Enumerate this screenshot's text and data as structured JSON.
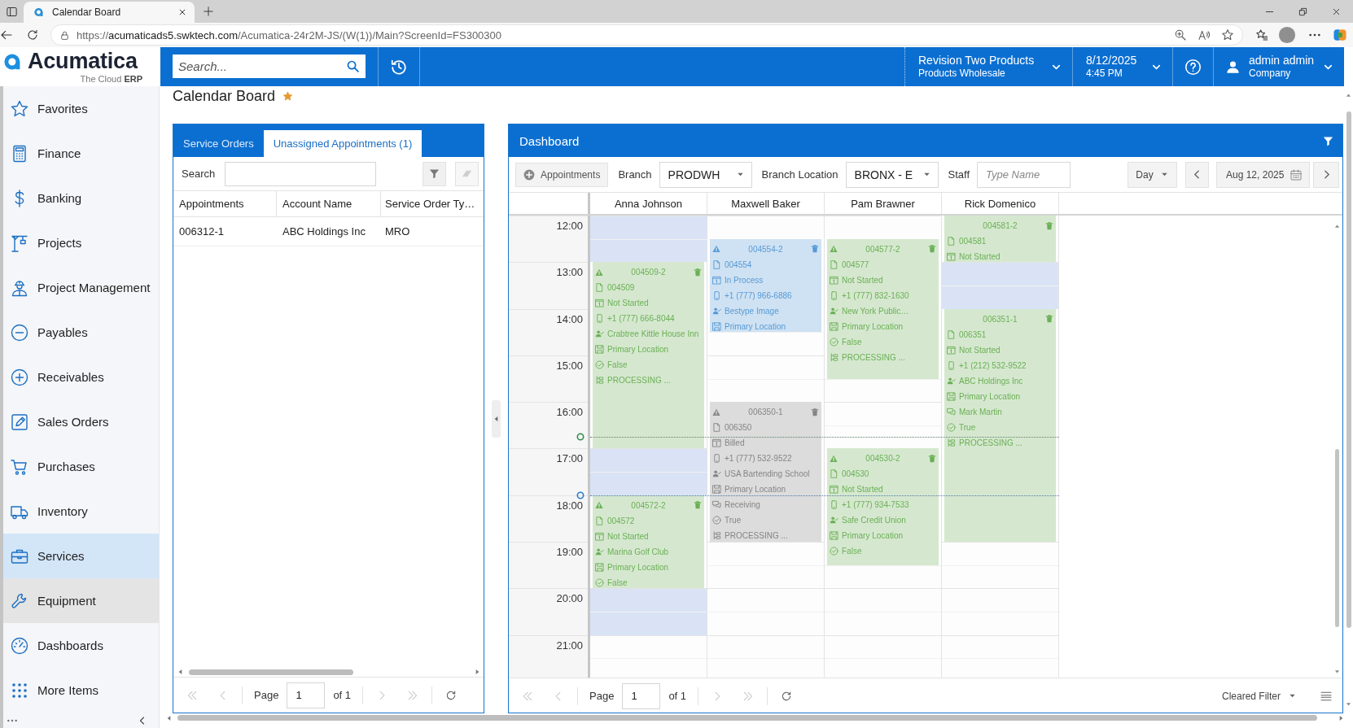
{
  "browser": {
    "tab_title": "Calendar Board",
    "url": {
      "scheme": "https://",
      "host": "acumaticads5.swktech.com",
      "path": "/Acumatica-24r2M-JS/(W(1))/Main?ScreenId=FS300300"
    }
  },
  "header": {
    "logo": {
      "name": "Acumatica",
      "tagline": "The Cloud **ERP**"
    },
    "search": {
      "placeholder": "Search..."
    },
    "company": {
      "name": "Revision Two Products",
      "branch": "Products Wholesale"
    },
    "datetime": {
      "date": "8/12/2025",
      "time": "4:45 PM"
    },
    "user": {
      "name": "admin admin",
      "company": "Company"
    }
  },
  "sidebar": {
    "items": [
      {
        "label": "Favorites",
        "selected": false,
        "hovered": false
      },
      {
        "label": "Finance",
        "selected": false,
        "hovered": false
      },
      {
        "label": "Banking",
        "selected": false,
        "hovered": false
      },
      {
        "label": "Projects",
        "selected": false,
        "hovered": false
      },
      {
        "label": "Project Management",
        "selected": false,
        "hovered": false
      },
      {
        "label": "Payables",
        "selected": false,
        "hovered": false
      },
      {
        "label": "Receivables",
        "selected": false,
        "hovered": false
      },
      {
        "label": "Sales Orders",
        "selected": false,
        "hovered": false
      },
      {
        "label": "Purchases",
        "selected": false,
        "hovered": false
      },
      {
        "label": "Inventory",
        "selected": false,
        "hovered": false
      },
      {
        "label": "Services",
        "selected": true,
        "hovered": false
      },
      {
        "label": "Equipment",
        "selected": false,
        "hovered": true
      },
      {
        "label": "Dashboards",
        "selected": false,
        "hovered": false
      },
      {
        "label": "More Items",
        "selected": false,
        "hovered": false
      }
    ]
  },
  "page": {
    "title": "Calendar Board",
    "favorite": true
  },
  "left_panel": {
    "tabs": [
      {
        "label": "Service Orders",
        "selected": false
      },
      {
        "label": "Unassigned Appointments (1)",
        "selected": true
      }
    ],
    "search": {
      "label": "Search"
    },
    "search_buttons": [
      {
        "kind": "filter",
        "disabled": false
      },
      {
        "kind": "clear",
        "disabled": true
      }
    ],
    "table": {
      "columns": [
        "Appointments",
        "Account Name",
        "Service Order Ty…"
      ],
      "rows": [
        [
          "006312-1",
          "ABC Holdings Inc",
          "MRO"
        ]
      ]
    },
    "pager": {
      "label": "Page",
      "page": "1",
      "total": "of 1",
      "nav_disabled": true
    }
  },
  "dashboard": {
    "title": "Dashboard",
    "toolbar": {
      "add_button": "Appointments",
      "branch": {
        "label": "Branch",
        "value": "PRODWH"
      },
      "branch_location": {
        "label": "Branch Location",
        "value": "BRONX - E"
      },
      "staff": {
        "label": "Staff",
        "placeholder": "Type Name"
      },
      "view": "Day",
      "date": "Aug 12, 2025"
    },
    "calendar": {
      "hours": [
        {
          "label": "12:00",
          "marked": false
        },
        {
          "label": "13:00",
          "marked": false
        },
        {
          "label": "14:00",
          "marked": false
        },
        {
          "label": "15:00",
          "marked": false
        },
        {
          "label": "16:00",
          "marked": false
        },
        {
          "label": "17:00",
          "marked": false
        },
        {
          "label": "18:00",
          "marked": true
        },
        {
          "label": "19:00",
          "marked": false
        },
        {
          "label": "20:00",
          "marked": false
        },
        {
          "label": "21:00",
          "marked": false
        }
      ],
      "staff": [
        {
          "name": "Anna Johnson",
          "timeline": [
            {
              "kind": "free",
              "shaded": true
            },
            {
              "kind": "free",
              "shaded": true
            },
            {
              "kind": "appointment",
              "id": "004509-2",
              "warning": true,
              "color": "#d5e8cf",
              "lines": [
                {
                  "kind": "order",
                  "text": "004509"
                },
                {
                  "kind": "status",
                  "text": "Not Started"
                },
                {
                  "kind": "phone",
                  "text": "+1 (777) 666-8044"
                },
                {
                  "kind": "customer",
                  "text": "Crabtree Kittle House Inn"
                },
                {
                  "kind": "location",
                  "text": "Primary Location"
                },
                {
                  "kind": "confirmed",
                  "text": "False"
                },
                {
                  "kind": "workflow",
                  "text": "PROCESSING ..."
                }
              ]
            },
            {
              "kind": "continued"
            },
            {
              "kind": "continued"
            },
            {
              "kind": "continued"
            },
            {
              "kind": "continued"
            },
            {
              "kind": "continued"
            },
            {
              "kind": "continued"
            },
            {
              "kind": "continued"
            },
            {
              "kind": "free",
              "shaded": true
            },
            {
              "kind": "free",
              "shaded": true
            },
            {
              "kind": "appointment",
              "id": "004572-2",
              "warning": true,
              "color": "#d5e8cf",
              "lines": [
                {
                  "kind": "order",
                  "text": "004572"
                },
                {
                  "kind": "status",
                  "text": "Not Started"
                },
                {
                  "kind": "customer",
                  "text": "Marina Golf Club"
                },
                {
                  "kind": "location",
                  "text": "Primary Location"
                },
                {
                  "kind": "confirmed",
                  "text": "False"
                }
              ]
            },
            {
              "kind": "continued"
            },
            {
              "kind": "continued"
            },
            {
              "kind": "continued"
            },
            {
              "kind": "free",
              "shaded": true
            },
            {
              "kind": "free",
              "shaded": true
            },
            {
              "kind": "free",
              "shaded": false
            },
            {
              "kind": "free",
              "shaded": false
            }
          ]
        },
        {
          "name": "Maxwell Baker",
          "timeline": [
            {
              "kind": "free",
              "shaded": false
            },
            {
              "kind": "appointment",
              "id": "004554-2",
              "warning": true,
              "color": "#cfe2f3",
              "lines": [
                {
                  "kind": "order",
                  "text": "004554"
                },
                {
                  "kind": "status",
                  "text": "In Process"
                },
                {
                  "kind": "phone",
                  "text": "+1 (777) 966-6886"
                },
                {
                  "kind": "customer",
                  "text": "Bestype Image"
                },
                {
                  "kind": "location",
                  "text": "Primary Location"
                }
              ]
            },
            {
              "kind": "continued"
            },
            {
              "kind": "continued"
            },
            {
              "kind": "continued"
            },
            {
              "kind": "free",
              "shaded": false
            },
            {
              "kind": "free",
              "shaded": false
            },
            {
              "kind": "free",
              "shaded": false
            },
            {
              "kind": "appointment",
              "id": "006350-1",
              "warning": true,
              "color": "#dcdcdc",
              "lines": [
                {
                  "kind": "order",
                  "text": "006350"
                },
                {
                  "kind": "status",
                  "text": "Billed"
                },
                {
                  "kind": "phone",
                  "text": "+1 (777) 532-9522"
                },
                {
                  "kind": "customer",
                  "text": "USA Bartending School"
                },
                {
                  "kind": "location",
                  "text": "Primary Location"
                },
                {
                  "kind": "contact",
                  "text": "Receiving"
                },
                {
                  "kind": "confirmed",
                  "text": "True"
                },
                {
                  "kind": "workflow",
                  "text": "PROCESSING ..."
                }
              ]
            },
            {
              "kind": "continued"
            },
            {
              "kind": "continued"
            },
            {
              "kind": "continued"
            },
            {
              "kind": "continued"
            },
            {
              "kind": "continued"
            },
            {
              "kind": "free",
              "shaded": false
            },
            {
              "kind": "free",
              "shaded": false
            },
            {
              "kind": "free",
              "shaded": false
            },
            {
              "kind": "free",
              "shaded": false
            },
            {
              "kind": "free",
              "shaded": false
            },
            {
              "kind": "free",
              "shaded": false
            }
          ]
        },
        {
          "name": "Pam Brawner",
          "timeline": [
            {
              "kind": "free",
              "shaded": false
            },
            {
              "kind": "appointment",
              "id": "004577-2",
              "warning": true,
              "color": "#d5e8cf",
              "lines": [
                {
                  "kind": "order",
                  "text": "004577"
                },
                {
                  "kind": "status",
                  "text": "Not Started"
                },
                {
                  "kind": "phone",
                  "text": "+1 (777) 832-1630"
                },
                {
                  "kind": "customer",
                  "text": "New York Public…"
                },
                {
                  "kind": "location",
                  "text": "Primary Location"
                },
                {
                  "kind": "confirmed",
                  "text": "False"
                },
                {
                  "kind": "workflow",
                  "text": "PROCESSING ..."
                }
              ]
            },
            {
              "kind": "continued"
            },
            {
              "kind": "continued"
            },
            {
              "kind": "continued"
            },
            {
              "kind": "continued"
            },
            {
              "kind": "continued"
            },
            {
              "kind": "free",
              "shaded": false
            },
            {
              "kind": "free",
              "shaded": false
            },
            {
              "kind": "free",
              "shaded": false
            },
            {
              "kind": "appointment",
              "id": "004530-2",
              "warning": true,
              "color": "#d5e8cf",
              "lines": [
                {
                  "kind": "order",
                  "text": "004530"
                },
                {
                  "kind": "status",
                  "text": "Not Started"
                },
                {
                  "kind": "phone",
                  "text": "+1 (777) 934-7533"
                },
                {
                  "kind": "customer",
                  "text": "Safe Credit Union"
                },
                {
                  "kind": "location",
                  "text": "Primary Location"
                },
                {
                  "kind": "confirmed",
                  "text": "False"
                }
              ]
            },
            {
              "kind": "continued"
            },
            {
              "kind": "continued"
            },
            {
              "kind": "continued"
            },
            {
              "kind": "continued"
            },
            {
              "kind": "free",
              "shaded": false
            },
            {
              "kind": "free",
              "shaded": false
            },
            {
              "kind": "free",
              "shaded": false
            },
            {
              "kind": "free",
              "shaded": false
            },
            {
              "kind": "free",
              "shaded": false
            }
          ]
        },
        {
          "name": "Rick Domenico",
          "timeline": [
            {
              "kind": "appointment",
              "id": "004581-2",
              "warning": false,
              "color": "#d5e8cf",
              "lines": [
                {
                  "kind": "order",
                  "text": "004581"
                },
                {
                  "kind": "status",
                  "text": "Not Started"
                }
              ]
            },
            {
              "kind": "continued"
            },
            {
              "kind": "free",
              "shaded": true
            },
            {
              "kind": "free",
              "shaded": true
            },
            {
              "kind": "appointment",
              "id": "006351-1",
              "warning": false,
              "color": "#d5e8cf",
              "lines": [
                {
                  "kind": "order",
                  "text": "006351"
                },
                {
                  "kind": "status",
                  "text": "Not Started"
                },
                {
                  "kind": "phone",
                  "text": "+1 (212) 532-9522"
                },
                {
                  "kind": "customer",
                  "text": "ABC Holdings Inc"
                },
                {
                  "kind": "location",
                  "text": "Primary Location"
                },
                {
                  "kind": "contact",
                  "text": "Mark Martin"
                },
                {
                  "kind": "confirmed",
                  "text": "True"
                },
                {
                  "kind": "workflow",
                  "text": "PROCESSING ..."
                }
              ]
            },
            {
              "kind": "continued"
            },
            {
              "kind": "continued"
            },
            {
              "kind": "continued"
            },
            {
              "kind": "continued"
            },
            {
              "kind": "continued"
            },
            {
              "kind": "continued"
            },
            {
              "kind": "continued"
            },
            {
              "kind": "continued"
            },
            {
              "kind": "continued"
            },
            {
              "kind": "free",
              "shaded": false
            },
            {
              "kind": "free",
              "shaded": false
            },
            {
              "kind": "free",
              "shaded": false
            },
            {
              "kind": "free",
              "shaded": false
            },
            {
              "kind": "free",
              "shaded": false
            },
            {
              "kind": "free",
              "shaded": false
            }
          ]
        }
      ]
    },
    "pager": {
      "label": "Page",
      "page": "1",
      "total": "of 1",
      "nav_disabled": true
    },
    "filter_status": "Cleared Filter"
  }
}
